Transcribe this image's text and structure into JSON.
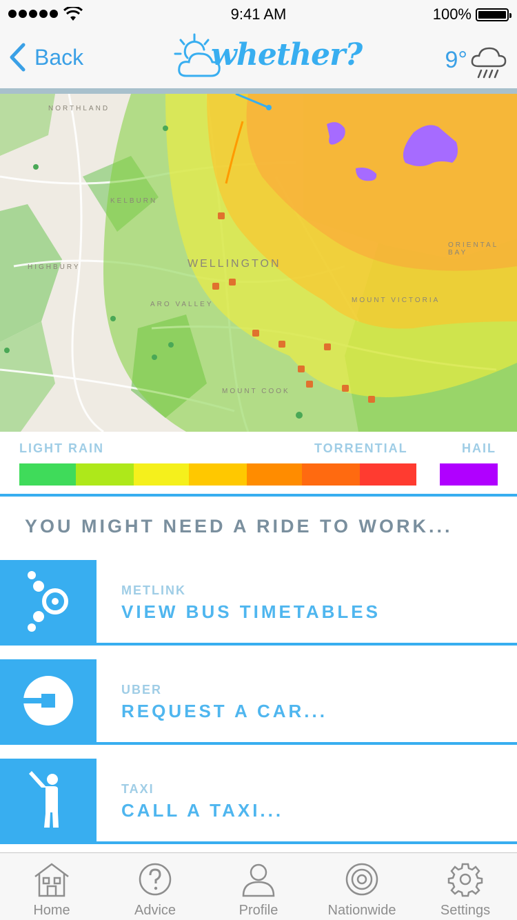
{
  "status_bar": {
    "time": "9:41 AM",
    "battery": "100%"
  },
  "nav": {
    "back_label": "Back",
    "logo_text": "whether?",
    "temperature": "9°",
    "weather_icon": "rain-cloud-icon"
  },
  "map": {
    "labels": [
      "NORTHLAND",
      "KELBURN",
      "WELLINGTON",
      "ARO VALLEY",
      "MOUNT COOK",
      "MOUNT VICTORIA",
      "ORIENTAL BAY",
      "HIGHBURY"
    ]
  },
  "legend": {
    "light_label": "LIGHT RAIN",
    "torrential_label": "TORRENTIAL",
    "hail_label": "HAIL",
    "colors": [
      "#3fdb5a",
      "#aee81a",
      "#f5f01c",
      "#ffc800",
      "#ff8c00",
      "#ff6a10",
      "#ff3b30"
    ],
    "hail_color": "#b000ff"
  },
  "section_title": "YOU MIGHT NEED A RIDE TO WORK...",
  "rides": [
    {
      "provider": "METLINK",
      "action": "VIEW BUS TIMETABLES",
      "icon": "metlink-icon"
    },
    {
      "provider": "UBER",
      "action": "REQUEST A CAR...",
      "icon": "uber-icon"
    },
    {
      "provider": "TAXI",
      "action": "CALL A TAXI...",
      "icon": "taxi-person-icon"
    }
  ],
  "tabs": [
    {
      "label": "Home",
      "icon": "home-icon"
    },
    {
      "label": "Advice",
      "icon": "question-icon"
    },
    {
      "label": "Profile",
      "icon": "person-icon"
    },
    {
      "label": "Nationwide",
      "icon": "target-icon"
    },
    {
      "label": "Settings",
      "icon": "gear-icon"
    }
  ],
  "colors": {
    "accent": "#38aef0",
    "muted_label": "#9fcde6",
    "heading": "#7a8f9e"
  }
}
